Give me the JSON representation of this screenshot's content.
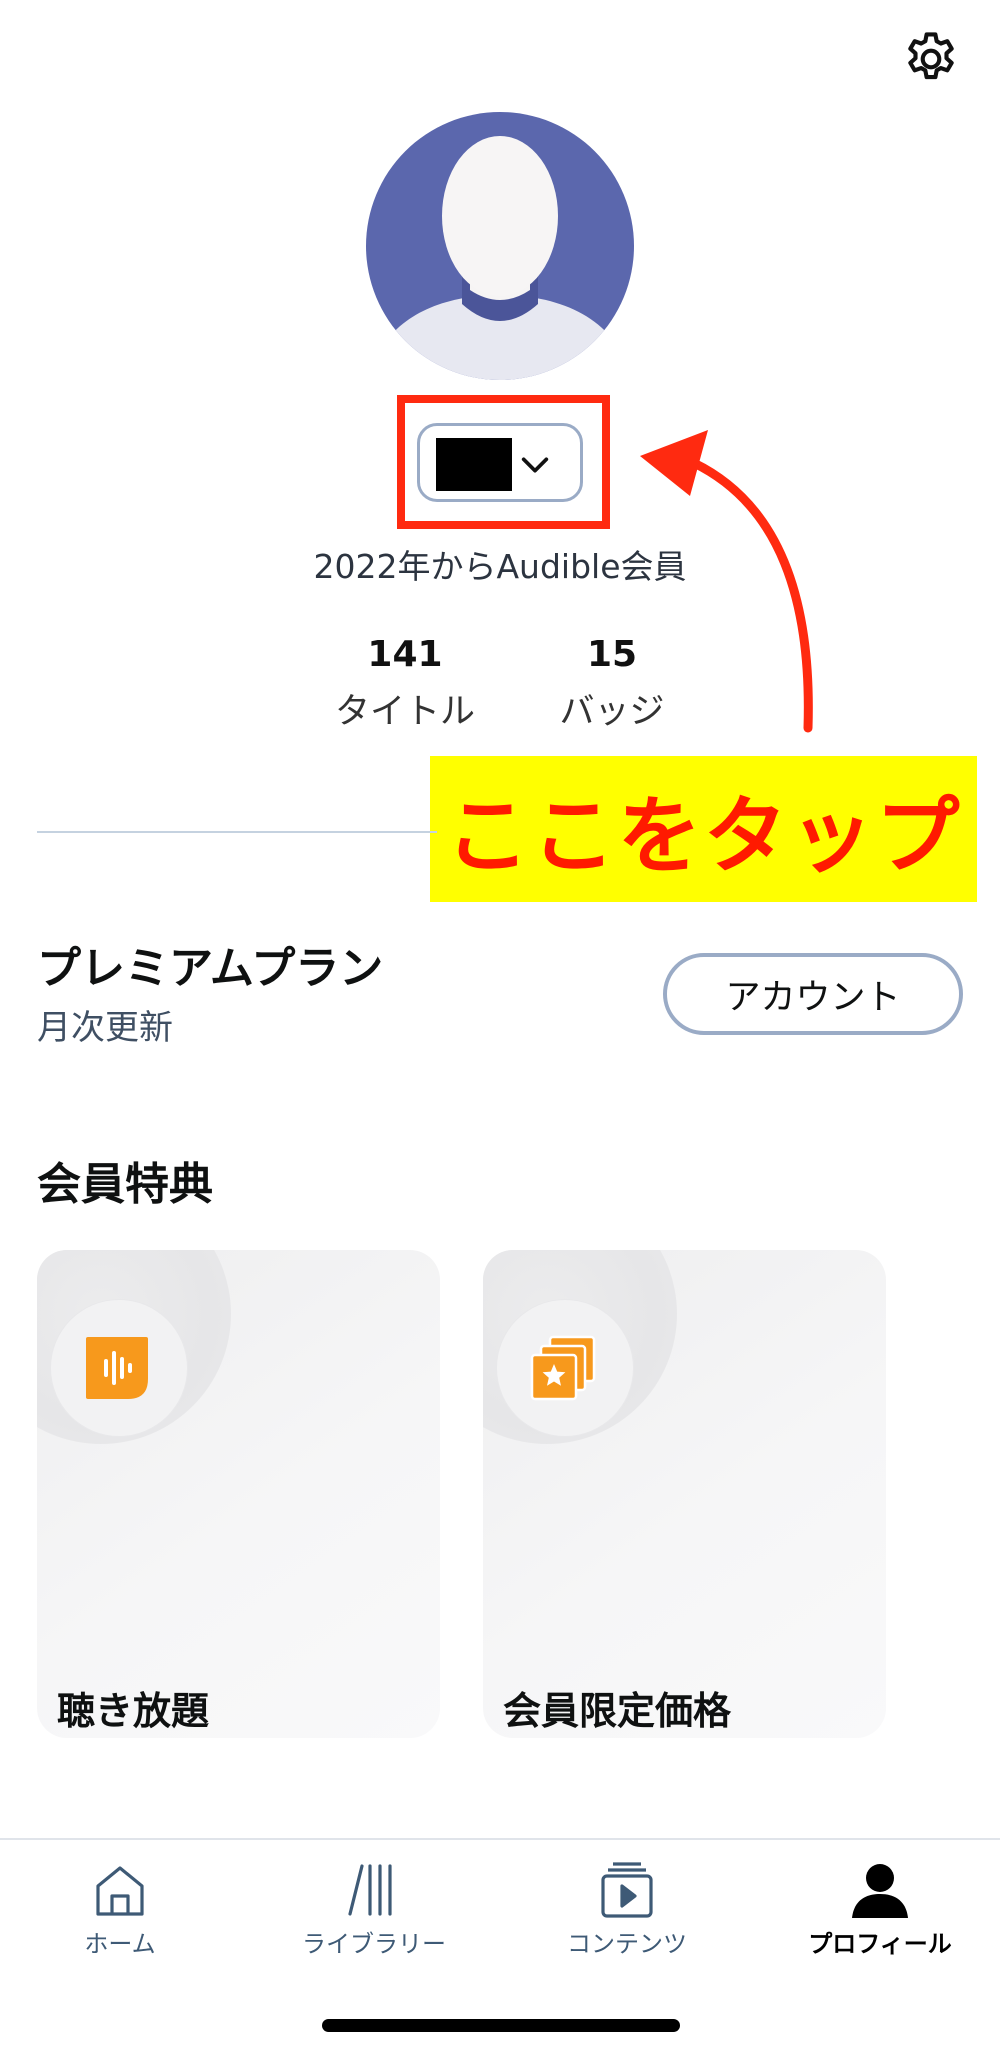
{
  "header": {
    "settings_icon": "gear-icon"
  },
  "profile": {
    "avatar_icon": "default-avatar",
    "name_redacted": true,
    "member_since": "2022年からAudible会員",
    "stats": [
      {
        "value": "141",
        "label": "タイトル"
      },
      {
        "value": "15",
        "label": "バッジ"
      }
    ]
  },
  "annotation": {
    "label": "ここをタップ",
    "color": "#ff2a10",
    "highlight": "#ffff00"
  },
  "plan": {
    "title": "プレミアムプラン",
    "subtitle": "月次更新",
    "account_button": "アカウント"
  },
  "benefits": {
    "heading": "会員特典",
    "cards": [
      {
        "title": "聴き放題",
        "icon": "audio-wave-icon"
      },
      {
        "title": "会員限定価格",
        "icon": "stacked-star-cards-icon"
      }
    ],
    "icon_color": "#f7991c"
  },
  "tabbar": {
    "tabs": [
      {
        "label": "ホーム",
        "icon": "home-icon"
      },
      {
        "label": "ライブラリー",
        "icon": "library-icon"
      },
      {
        "label": "コンテンツ",
        "icon": "play-cards-icon"
      },
      {
        "label": "プロフィール",
        "icon": "person-icon",
        "active": true
      }
    ]
  }
}
